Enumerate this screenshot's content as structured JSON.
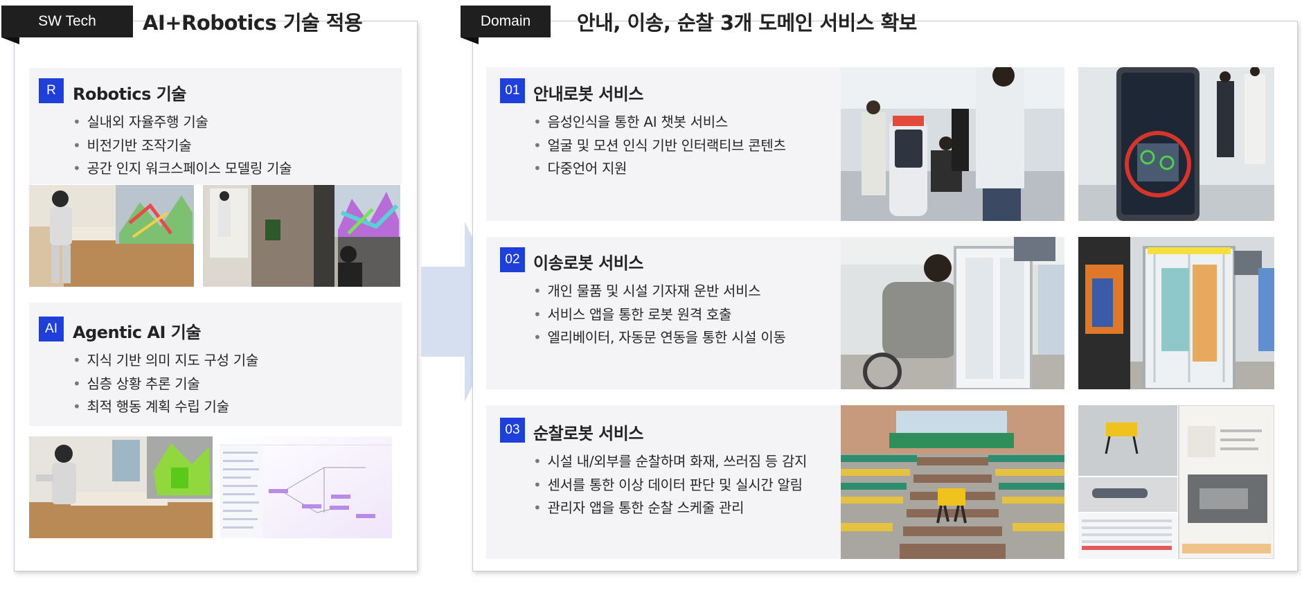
{
  "left": {
    "tag": "SW Tech",
    "title": "AI+Robotics 기술 적용",
    "cards": [
      {
        "badge": "R",
        "title": "Robotics 기술",
        "items": [
          "실내외 자율주행 기술",
          "비전기반 조작기술",
          "공간 인지 워크스페이스 모델링 기술"
        ]
      },
      {
        "badge": "AI",
        "title": "Agentic AI 기술",
        "items": [
          "지식 기반 의미 지도 구성 기술",
          "심층 상황 추론 기술",
          "최적 행동 계획 수립 기술"
        ]
      }
    ]
  },
  "right": {
    "tag": "Domain",
    "title": "안내, 이송, 순찰 3개 도메인 서비스 확보",
    "cards": [
      {
        "badge": "01",
        "title": "안내로봇 서비스",
        "items": [
          "음성인식을 통한 AI 챗봇 서비스",
          "얼굴 및 모션 인식 기반 인터랙티브 콘텐츠",
          "다중언어 지원"
        ]
      },
      {
        "badge": "02",
        "title": "이송로봇 서비스",
        "items": [
          "개인 물품 및 시설 기자재 운반 서비스",
          "서비스 앱을 통한 로봇 원격 호출",
          "엘리베이터, 자동문 연동을 통한 시설 이동"
        ]
      },
      {
        "badge": "03",
        "title": "순찰로봇 서비스",
        "items": [
          "시설 내/외부를 순찰하며 화재, 쓰러짐 등 감지",
          "센서를 통한 이상 데이터 판단 및 실시간 알림",
          "관리자 앱을 통한 순찰 스케줄 관리"
        ]
      }
    ]
  },
  "colors": {
    "tag_bg": "#1f1f1f",
    "badge_blue": "#1f3fd9",
    "card_bg": "#f4f4f6",
    "arrow": "#d5dff0"
  },
  "icons": [
    "big-right-arrow",
    "photo-humanoid-robot",
    "photo-point-cloud",
    "photo-guide-robot",
    "photo-transport-robot",
    "photo-quadruped-robot"
  ]
}
